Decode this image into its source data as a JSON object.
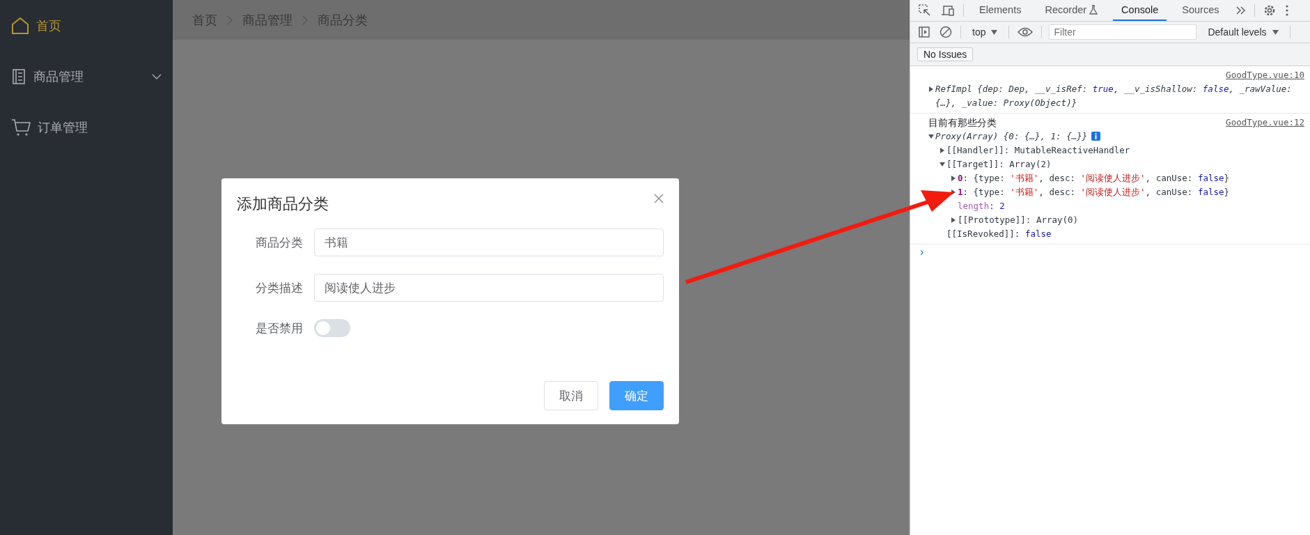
{
  "sidebar": {
    "items": [
      {
        "label": "首页",
        "kind": "item",
        "selected": true
      },
      {
        "label": "商品管理",
        "kind": "submenu",
        "selected": false,
        "expanded": false
      },
      {
        "label": "订单管理",
        "kind": "item",
        "selected": false
      }
    ]
  },
  "breadcrumb": [
    "首页",
    "商品管理",
    "商品分类"
  ],
  "dialog": {
    "title": "添加商品分类",
    "fields": [
      {
        "label": "商品分类",
        "kind": "input",
        "value": "书籍"
      },
      {
        "label": "分类描述",
        "kind": "input",
        "value": "阅读使人进步"
      },
      {
        "label": "是否禁用",
        "kind": "switch",
        "on": false
      }
    ],
    "buttons": [
      {
        "label": "取消",
        "kind": "default"
      },
      {
        "label": "确定",
        "kind": "primary"
      }
    ]
  },
  "devtools": {
    "tabs": [
      {
        "label": "Elements",
        "selected": false,
        "kind": "plain"
      },
      {
        "label": "Recorder",
        "selected": false,
        "kind": "flask"
      },
      {
        "label": "Console",
        "selected": true,
        "kind": "plain"
      },
      {
        "label": "Sources",
        "selected": false,
        "kind": "plain"
      }
    ],
    "context": "top",
    "filter": {
      "placeholder": "Filter"
    },
    "levels": "Default levels",
    "issues": "No Issues",
    "entries": [
      {
        "source": "GoodType.vue:10",
        "tree": [
          {
            "expanded": false,
            "kind": "node",
            "italic": true,
            "segments": [
              {
                "text": "RefImpl {dep: Dep, __v_isRef: ",
                "kind": "plain"
              },
              {
                "text": "true",
                "kind": "keyword"
              },
              {
                "text": ", __v_isShallow: ",
                "kind": "plain"
              },
              {
                "text": "false",
                "kind": "keyword"
              },
              {
                "text": ", _rawValue: {…}, _value: Proxy(Object)}",
                "kind": "plain"
              }
            ]
          }
        ]
      },
      {
        "source": "GoodType.vue:12",
        "message": "目前有那些分类",
        "tree": [
          {
            "expanded": true,
            "kind": "node",
            "italic": true,
            "info": true,
            "segments": [
              {
                "text": "Proxy(Array) {0: {…}, 1: {…}}",
                "kind": "plain"
              }
            ],
            "children": [
              {
                "expanded": false,
                "kind": "node",
                "segments": [
                  {
                    "text": "[[Handler]]: MutableReactiveHandler",
                    "kind": "plain"
                  }
                ]
              },
              {
                "expanded": true,
                "kind": "node",
                "segments": [
                  {
                    "text": "[[Target]]: Array(2)",
                    "kind": "plain"
                  }
                ],
                "children": [
                  {
                    "expanded": false,
                    "kind": "node",
                    "segments": [
                      {
                        "text": "0",
                        "kind": "key"
                      },
                      {
                        "text": ": {type: ",
                        "kind": "plain"
                      },
                      {
                        "text": "'书籍'",
                        "kind": "string"
                      },
                      {
                        "text": ", desc: ",
                        "kind": "plain"
                      },
                      {
                        "text": "'阅读使人进步'",
                        "kind": "string"
                      },
                      {
                        "text": ", canUse: ",
                        "kind": "plain"
                      },
                      {
                        "text": "false",
                        "kind": "keyword"
                      },
                      {
                        "text": "}",
                        "kind": "plain"
                      }
                    ]
                  },
                  {
                    "expanded": false,
                    "kind": "node",
                    "segments": [
                      {
                        "text": "1",
                        "kind": "key"
                      },
                      {
                        "text": ": {type: ",
                        "kind": "plain"
                      },
                      {
                        "text": "'书籍'",
                        "kind": "string"
                      },
                      {
                        "text": ", desc: ",
                        "kind": "plain"
                      },
                      {
                        "text": "'阅读使人进步'",
                        "kind": "string"
                      },
                      {
                        "text": ", canUse: ",
                        "kind": "plain"
                      },
                      {
                        "text": "false",
                        "kind": "keyword"
                      },
                      {
                        "text": "}",
                        "kind": "plain"
                      }
                    ]
                  },
                  {
                    "kind": "leaf",
                    "segments": [
                      {
                        "text": "length",
                        "kind": "prop"
                      },
                      {
                        "text": ": ",
                        "kind": "plain"
                      },
                      {
                        "text": "2",
                        "kind": "keyword"
                      }
                    ]
                  },
                  {
                    "expanded": false,
                    "kind": "node",
                    "segments": [
                      {
                        "text": "[[Prototype]]: Array(0)",
                        "kind": "plain"
                      }
                    ]
                  }
                ]
              },
              {
                "kind": "leaf",
                "segments": [
                  {
                    "text": "[[IsRevoked]]: ",
                    "kind": "plain"
                  },
                  {
                    "text": "false",
                    "kind": "keyword"
                  }
                ]
              }
            ]
          }
        ]
      }
    ],
    "prompt": "›"
  }
}
